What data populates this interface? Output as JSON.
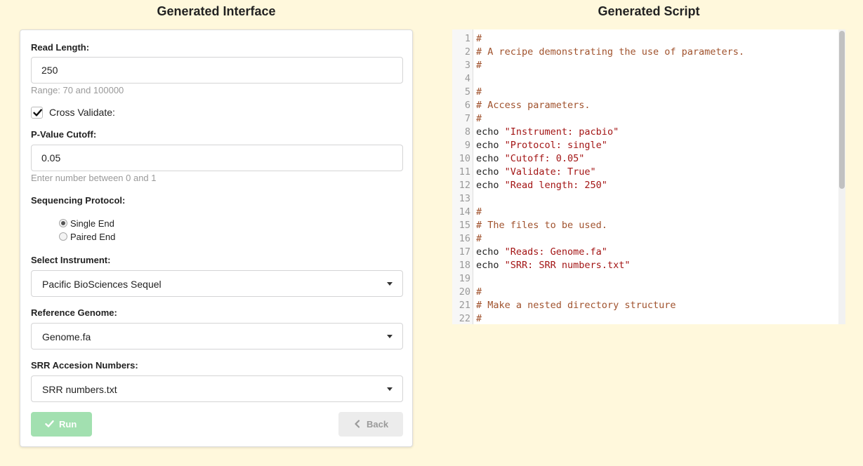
{
  "headings": {
    "left": "Generated Interface",
    "right": "Generated Script"
  },
  "form": {
    "read_length": {
      "label": "Read Length:",
      "value": "250",
      "hint": "Range: 70 and 100000"
    },
    "cross_validate": {
      "label": "Cross Validate:",
      "checked": true
    },
    "pvalue": {
      "label": "P-Value Cutoff:",
      "value": "0.05",
      "hint": "Enter number between 0 and 1"
    },
    "protocol": {
      "label": "Sequencing Protocol:",
      "options": [
        {
          "label": "Single End",
          "checked": true
        },
        {
          "label": "Paired End",
          "checked": false
        }
      ]
    },
    "instrument": {
      "label": "Select Instrument:",
      "value": "Pacific BioSciences Sequel"
    },
    "reference": {
      "label": "Reference Genome:",
      "value": "Genome.fa"
    },
    "srr": {
      "label": "SRR Accesion Numbers:",
      "value": "SRR numbers.txt"
    },
    "run_label": "Run",
    "back_label": "Back"
  },
  "script": {
    "lines": [
      {
        "n": "1",
        "comment": "#"
      },
      {
        "n": "2",
        "comment": "# A recipe demonstrating the use of parameters."
      },
      {
        "n": "3",
        "comment": "#"
      },
      {
        "n": "4",
        "comment": ""
      },
      {
        "n": "5",
        "comment": "#"
      },
      {
        "n": "6",
        "comment": "# Access parameters."
      },
      {
        "n": "7",
        "comment": "#"
      },
      {
        "n": "8",
        "kw": "echo ",
        "str": "\"Instrument: pacbio\""
      },
      {
        "n": "9",
        "kw": "echo ",
        "str": "\"Protocol: single\""
      },
      {
        "n": "10",
        "kw": "echo ",
        "str": "\"Cutoff: 0.05\""
      },
      {
        "n": "11",
        "kw": "echo ",
        "str": "\"Validate: True\""
      },
      {
        "n": "12",
        "kw": "echo ",
        "str": "\"Read length: 250\""
      },
      {
        "n": "13",
        "comment": ""
      },
      {
        "n": "14",
        "comment": "#"
      },
      {
        "n": "15",
        "comment": "# The files to be used."
      },
      {
        "n": "16",
        "comment": "#"
      },
      {
        "n": "17",
        "kw": "echo ",
        "str": "\"Reads: Genome.fa\""
      },
      {
        "n": "18",
        "kw": "echo ",
        "str": "\"SRR: SRR numbers.txt\""
      },
      {
        "n": "19",
        "comment": ""
      },
      {
        "n": "20",
        "comment": "#"
      },
      {
        "n": "21",
        "comment": "# Make a nested directory structure"
      },
      {
        "n": "22",
        "comment": "#"
      }
    ]
  },
  "colors": {
    "page_bg": "#fff8dc",
    "run_button_bg": "#a2e0b0",
    "comment": "#a0522d",
    "string": "#a31515"
  }
}
